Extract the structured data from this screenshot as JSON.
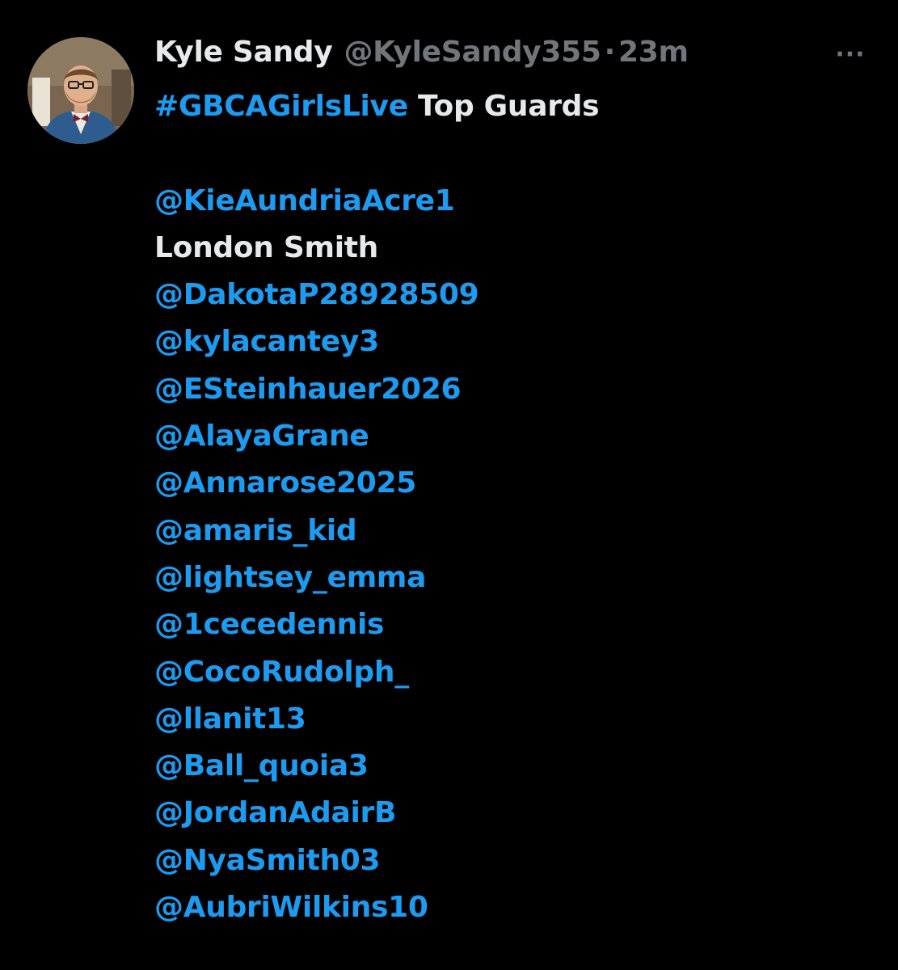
{
  "tweet": {
    "author_name": "Kyle Sandy",
    "author_handle": "@KyleSandy355",
    "separator": "·",
    "time": "23m",
    "more_label": "···",
    "hashtag": "#GBCAGirlsLive",
    "title_suffix": " Top Guards",
    "lines": [
      {
        "text": "@KieAundriaAcre1",
        "kind": "mention"
      },
      {
        "text": "London Smith",
        "kind": "plain"
      },
      {
        "text": "@DakotaP28928509",
        "kind": "mention"
      },
      {
        "text": "@kylacantey3",
        "kind": "mention"
      },
      {
        "text": "@ESteinhauer2026",
        "kind": "mention"
      },
      {
        "text": "@AlayaGrane",
        "kind": "mention"
      },
      {
        "text": "@Annarose2025",
        "kind": "mention"
      },
      {
        "text": "@amaris_kid",
        "kind": "mention"
      },
      {
        "text": "@lightsey_emma",
        "kind": "mention"
      },
      {
        "text": "@1cecedennis",
        "kind": "mention"
      },
      {
        "text": "@CocoRudolph_",
        "kind": "mention"
      },
      {
        "text": "@llanit13",
        "kind": "mention"
      },
      {
        "text": "@Ball_quoia3",
        "kind": "mention"
      },
      {
        "text": "@JordanAdairB",
        "kind": "mention"
      },
      {
        "text": "@NyaSmith03",
        "kind": "mention"
      },
      {
        "text": "@AubriWilkins10",
        "kind": "mention"
      }
    ]
  },
  "colors": {
    "background": "#000000",
    "text": "#e7e9ea",
    "secondary": "#71767b",
    "link": "#1d9bf0"
  },
  "icons": {
    "avatar": "profile-photo",
    "more": "more-horizontal-icon"
  }
}
